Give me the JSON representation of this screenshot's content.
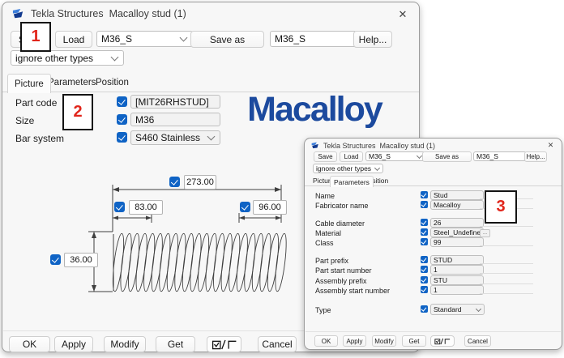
{
  "colors": {
    "accent_blue": "#0f63c5",
    "logo_blue": "#1c4a9e",
    "annotation_red": "#e1251b"
  },
  "icons": {
    "close": "✕"
  },
  "annotations": {
    "step1": "1",
    "step2": "2",
    "step3": "3"
  },
  "window1": {
    "title": "Tekla Structures  Macalloy stud (1)",
    "toolbar": {
      "save": "Save",
      "load": "Load",
      "profile": "M36_S",
      "save_as": "Save as",
      "profile_name": "M36_S",
      "help": "Help...",
      "filter": "ignore other types"
    },
    "tabs": {
      "picture": "Picture",
      "parameters": "Parameters",
      "position": "Position"
    },
    "fields": {
      "part_code": {
        "label": "Part code",
        "value": "[MIT26RHSTUD]"
      },
      "size": {
        "label": "Size",
        "value": "M36"
      },
      "bar_system": {
        "label": "Bar system",
        "value": "S460 Stainless"
      }
    },
    "logo": "Macalloy",
    "dimensions": {
      "overall": "273.00",
      "left_thread": "83.00",
      "right_thread": "96.00",
      "diameter": "36.00"
    },
    "footer": {
      "ok": "OK",
      "apply": "Apply",
      "modify": "Modify",
      "get": "Get",
      "cancel": "Cancel"
    }
  },
  "window2": {
    "title": "Tekla Structures  Macalloy stud (1)",
    "toolbar": {
      "save": "Save",
      "load": "Load",
      "profile": "M36_S",
      "save_as": "Save as",
      "profile_name": "M36_S",
      "help": "Help...",
      "filter": "ignore other types"
    },
    "tabs": {
      "picture": "Picture",
      "parameters": "Parameters",
      "position": "Position"
    },
    "params": {
      "name": {
        "label": "Name",
        "value": "Stud"
      },
      "fabricator": {
        "label": "Fabricator name",
        "value": "Macalloy"
      },
      "cable_diameter": {
        "label": "Cable diameter",
        "value": "26"
      },
      "material": {
        "label": "Material",
        "value": "Steel_Undefined"
      },
      "class": {
        "label": "Class",
        "value": "99"
      },
      "part_prefix": {
        "label": "Part prefix",
        "value": "STUD"
      },
      "part_start": {
        "label": "Part start number",
        "value": "1"
      },
      "assembly_prefix": {
        "label": "Assembly prefix",
        "value": "STU"
      },
      "assembly_start": {
        "label": "Assembly start number",
        "value": "1"
      },
      "type": {
        "label": "Type",
        "value": "Standard"
      }
    },
    "browse": "...",
    "footer": {
      "ok": "OK",
      "apply": "Apply",
      "modify": "Modify",
      "get": "Get",
      "cancel": "Cancel"
    }
  }
}
